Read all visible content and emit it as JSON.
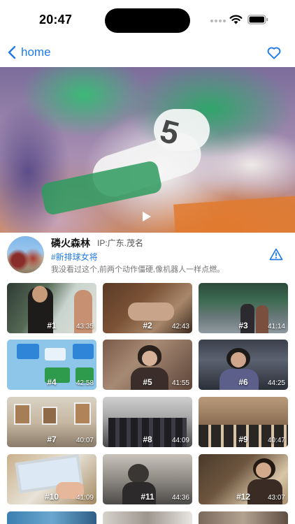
{
  "status_bar": {
    "time": "20:47"
  },
  "nav": {
    "back_label": "home"
  },
  "author": {
    "name": "磷火森林",
    "ip": "IP:广东.茂名",
    "tag": "#新排球女将",
    "description": "我没看过这个,前两个动作僵硬,像机器人一样点燃。"
  },
  "hero": {
    "jersey_number": "5"
  },
  "colors": {
    "accent": "#1f7ae6"
  },
  "videos": [
    {
      "num": "#1",
      "duration": "43:35"
    },
    {
      "num": "#2",
      "duration": "42:43"
    },
    {
      "num": "#3",
      "duration": "41:14"
    },
    {
      "num": "#4",
      "duration": "42:58"
    },
    {
      "num": "#5",
      "duration": "41:55"
    },
    {
      "num": "#6",
      "duration": "44:25"
    },
    {
      "num": "#7",
      "duration": "40:07"
    },
    {
      "num": "#8",
      "duration": "44:09"
    },
    {
      "num": "#9",
      "duration": "40:47"
    },
    {
      "num": "#10",
      "duration": "41:09"
    },
    {
      "num": "#11",
      "duration": "44:36"
    },
    {
      "num": "#12",
      "duration": "43:07"
    }
  ]
}
